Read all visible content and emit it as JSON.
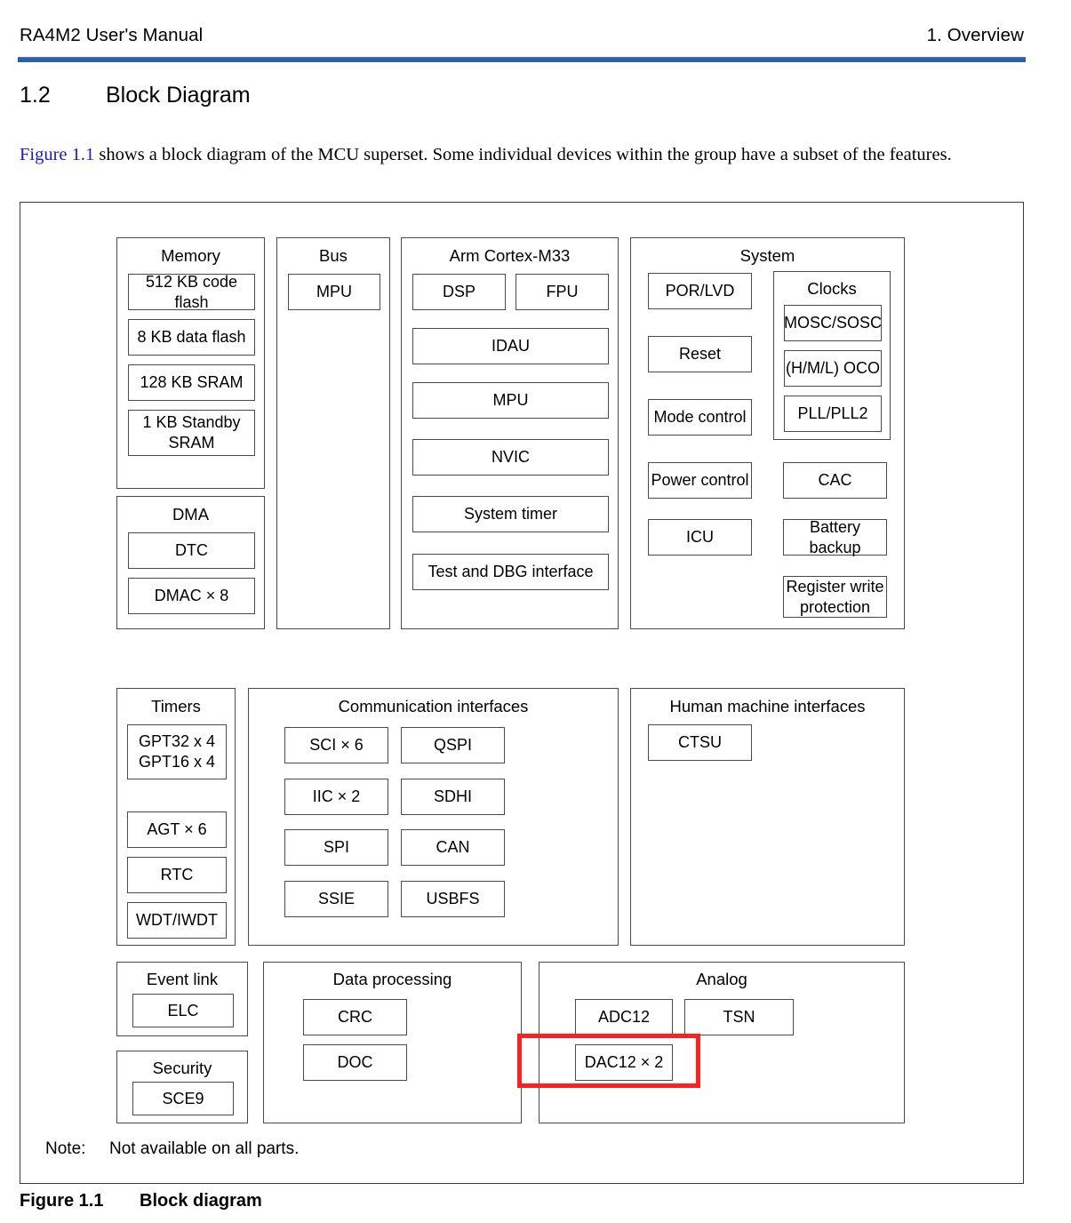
{
  "header": {
    "left": "RA4M2 User's Manual",
    "right": "1. Overview",
    "rule_color": "#2E5FA6"
  },
  "section": {
    "number": "1.2",
    "title": "Block Diagram"
  },
  "intro": {
    "figure_ref": "Figure 1.1",
    "figure_ref_color": "#1818C8",
    "text": " shows a block diagram of the MCU superset. Some individual devices within the group have a subset of the features."
  },
  "figure": {
    "note_label": "Note:",
    "note_text": "Not available on all parts.",
    "caption_number": "Figure 1.1",
    "caption_title": "Block diagram",
    "highlight_color": "#FB2121",
    "highlighted_block": "DAC12 × 2"
  },
  "groups": {
    "memory": {
      "title": "Memory",
      "blocks": [
        "512 KB code flash",
        "8 KB data flash",
        "128 KB SRAM",
        "1 KB Standby\nSRAM"
      ]
    },
    "dma": {
      "title": "DMA",
      "blocks": [
        "DTC",
        "DMAC × 8"
      ]
    },
    "bus": {
      "title": "Bus",
      "blocks": [
        "MPU"
      ]
    },
    "cortex": {
      "title": "Arm Cortex-M33",
      "blocks": [
        "DSP",
        "FPU",
        "IDAU",
        "MPU",
        "NVIC",
        "System timer",
        "Test and DBG interface"
      ]
    },
    "system": {
      "title": "System",
      "left_blocks": [
        "POR/LVD",
        "Reset",
        "Mode control",
        "Power control",
        "ICU"
      ],
      "clocks": {
        "title": "Clocks",
        "blocks": [
          "MOSC/SOSC",
          "(H/M/L) OCO",
          "PLL/PLL2"
        ]
      },
      "right_blocks": [
        "CAC",
        "Battery backup",
        "Register write\nprotection"
      ]
    },
    "timers": {
      "title": "Timers",
      "blocks": [
        "GPT32 x 4\nGPT16 x 4",
        "AGT × 6",
        "RTC",
        "WDT/IWDT"
      ]
    },
    "comm": {
      "title": "Communication interfaces",
      "left_blocks": [
        "SCI × 6",
        "IIC × 2",
        "SPI",
        "SSIE"
      ],
      "right_blocks": [
        "QSPI",
        "SDHI",
        "CAN",
        "USBFS"
      ]
    },
    "hmi": {
      "title": "Human machine interfaces",
      "blocks": [
        "CTSU"
      ]
    },
    "event_link": {
      "title": "Event link",
      "blocks": [
        "ELC"
      ]
    },
    "security": {
      "title": "Security",
      "blocks": [
        "SCE9"
      ]
    },
    "data_processing": {
      "title": "Data processing",
      "blocks": [
        "CRC",
        "DOC"
      ]
    },
    "analog": {
      "title": "Analog",
      "blocks": [
        "ADC12",
        "TSN",
        "DAC12 × 2"
      ]
    }
  }
}
